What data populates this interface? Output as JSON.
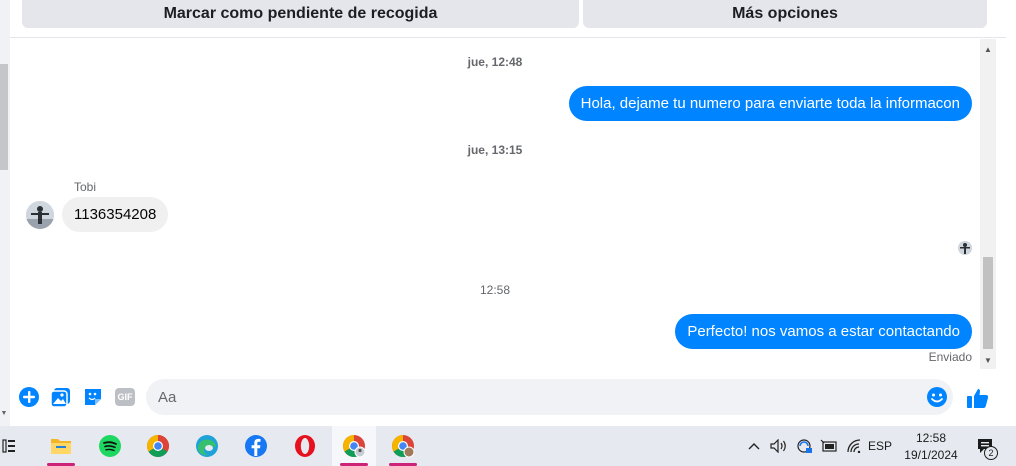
{
  "header": {
    "pending_button": "Marcar como pendiente de recogida",
    "more_button": "Más opciones"
  },
  "chat": {
    "timestamp_1": "jue, 12:48",
    "message_out_1": "Hola, dejame tu numero para enviarte toda la informacon",
    "timestamp_2": "jue, 13:15",
    "sender_name": "Tobi",
    "message_in_1": "1136354208",
    "timestamp_3": "12:58",
    "message_out_2": "Perfecto! nos vamos a estar contactando",
    "status": "Enviado"
  },
  "composer": {
    "placeholder": "Aa",
    "icons": [
      "plus-icon",
      "image-icon",
      "sticker-icon",
      "gif-icon",
      "emoji-icon",
      "like-icon"
    ],
    "gif_label": "GIF"
  },
  "taskbar": {
    "apps": [
      "task-view-icon",
      "file-explorer-icon",
      "spotify-icon",
      "chrome-icon",
      "edge-icon",
      "facebook-icon",
      "opera-icon",
      "chrome-profile-icon",
      "chrome-profile-2-icon"
    ],
    "language": "ESP",
    "time": "12:58",
    "date": "19/1/2024",
    "notifications": "2"
  },
  "colors": {
    "accent": "#0084ff",
    "incoming_bubble": "#f0f0f0",
    "taskbar_underline": "#cc2277"
  }
}
